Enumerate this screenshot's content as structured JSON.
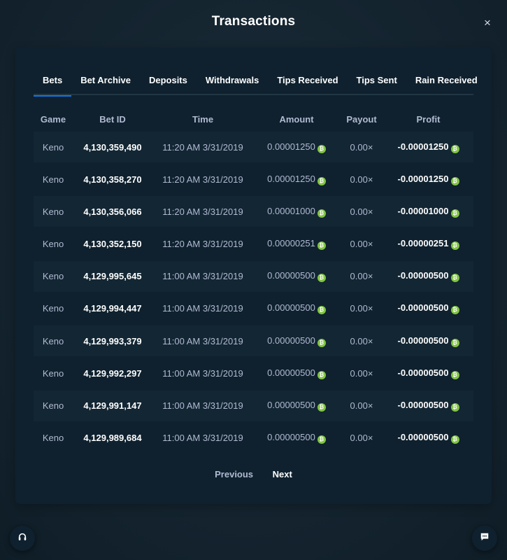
{
  "header": {
    "title": "Transactions",
    "close_label": "×"
  },
  "tabs": [
    {
      "label": "Bets",
      "active": true
    },
    {
      "label": "Bet Archive",
      "active": false
    },
    {
      "label": "Deposits",
      "active": false
    },
    {
      "label": "Withdrawals",
      "active": false
    },
    {
      "label": "Tips Received",
      "active": false
    },
    {
      "label": "Tips Sent",
      "active": false
    },
    {
      "label": "Rain Received",
      "active": false
    }
  ],
  "table": {
    "columns": {
      "game": "Game",
      "bet_id": "Bet ID",
      "time": "Time",
      "amount": "Amount",
      "payout": "Payout",
      "profit": "Profit"
    },
    "rows": [
      {
        "game": "Keno",
        "bet_id": "4,130,359,490",
        "time": "11:20 AM 3/31/2019",
        "amount": "0.00001250",
        "payout": "0.00×",
        "profit": "-0.00001250"
      },
      {
        "game": "Keno",
        "bet_id": "4,130,358,270",
        "time": "11:20 AM 3/31/2019",
        "amount": "0.00001250",
        "payout": "0.00×",
        "profit": "-0.00001250"
      },
      {
        "game": "Keno",
        "bet_id": "4,130,356,066",
        "time": "11:20 AM 3/31/2019",
        "amount": "0.00001000",
        "payout": "0.00×",
        "profit": "-0.00001000"
      },
      {
        "game": "Keno",
        "bet_id": "4,130,352,150",
        "time": "11:20 AM 3/31/2019",
        "amount": "0.00000251",
        "payout": "0.00×",
        "profit": "-0.00000251"
      },
      {
        "game": "Keno",
        "bet_id": "4,129,995,645",
        "time": "11:00 AM 3/31/2019",
        "amount": "0.00000500",
        "payout": "0.00×",
        "profit": "-0.00000500"
      },
      {
        "game": "Keno",
        "bet_id": "4,129,994,447",
        "time": "11:00 AM 3/31/2019",
        "amount": "0.00000500",
        "payout": "0.00×",
        "profit": "-0.00000500"
      },
      {
        "game": "Keno",
        "bet_id": "4,129,993,379",
        "time": "11:00 AM 3/31/2019",
        "amount": "0.00000500",
        "payout": "0.00×",
        "profit": "-0.00000500"
      },
      {
        "game": "Keno",
        "bet_id": "4,129,992,297",
        "time": "11:00 AM 3/31/2019",
        "amount": "0.00000500",
        "payout": "0.00×",
        "profit": "-0.00000500"
      },
      {
        "game": "Keno",
        "bet_id": "4,129,991,147",
        "time": "11:00 AM 3/31/2019",
        "amount": "0.00000500",
        "payout": "0.00×",
        "profit": "-0.00000500"
      },
      {
        "game": "Keno",
        "bet_id": "4,129,989,684",
        "time": "11:00 AM 3/31/2019",
        "amount": "0.00000500",
        "payout": "0.00×",
        "profit": "-0.00000500"
      }
    ]
  },
  "currency_icon": "bitcoin-coin-icon",
  "pagination": {
    "previous": "Previous",
    "next": "Next"
  },
  "fabs": {
    "support_icon": "headset-icon",
    "chat_icon": "chat-bubble-icon"
  },
  "colors": {
    "background": "#12232e",
    "panel": "#0f212e",
    "accent": "#1475e1",
    "coin": "#81c443"
  }
}
